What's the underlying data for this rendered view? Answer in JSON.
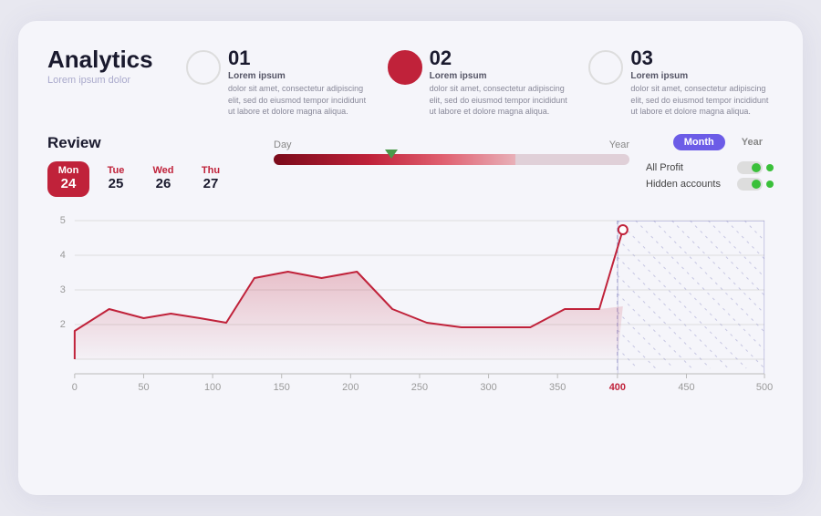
{
  "app": {
    "title": "Analytics",
    "subtitle": "Lorem ipsum dolor"
  },
  "stats": [
    {
      "number": "01",
      "title": "Lorem ipsum",
      "description": "dolor sit amet, consectetur adipiscing elit, sed do eiusmod tempor incididunt ut labore et dolore magna aliqua.",
      "filled": false
    },
    {
      "number": "02",
      "title": "Lorem ipsum",
      "description": "dolor sit amet, consectetur adipiscing elit, sed do eiusmod tempor incididunt ut labore et dolore magna aliqua.",
      "filled": true
    },
    {
      "number": "03",
      "title": "Lorem ipsum",
      "description": "dolor sit amet, consectetur adipiscing elit, sed do eiusmod tempor incididunt ut labore et dolore magna aliqua.",
      "filled": false
    }
  ],
  "review": {
    "title": "Review",
    "days": [
      {
        "name": "Mon",
        "num": "24",
        "active": true
      },
      {
        "name": "Tue",
        "num": "25",
        "active": false
      },
      {
        "name": "Wed",
        "num": "26",
        "active": false
      },
      {
        "name": "Thu",
        "num": "27",
        "active": false
      }
    ]
  },
  "slider": {
    "label_left": "Day",
    "label_right": "Year"
  },
  "toggle": {
    "month_label": "Month",
    "year_label": "Year"
  },
  "legend": {
    "all_profit": "All Profit",
    "hidden_accounts": "Hidden accounts"
  },
  "chart": {
    "x_labels": [
      "0",
      "50",
      "100",
      "150",
      "200",
      "250",
      "300",
      "350",
      "400",
      "450",
      "500"
    ],
    "y_labels": [
      "5",
      "4",
      "3",
      "2"
    ]
  },
  "icons": {
    "circle_empty": "○",
    "circle_filled": "●"
  }
}
